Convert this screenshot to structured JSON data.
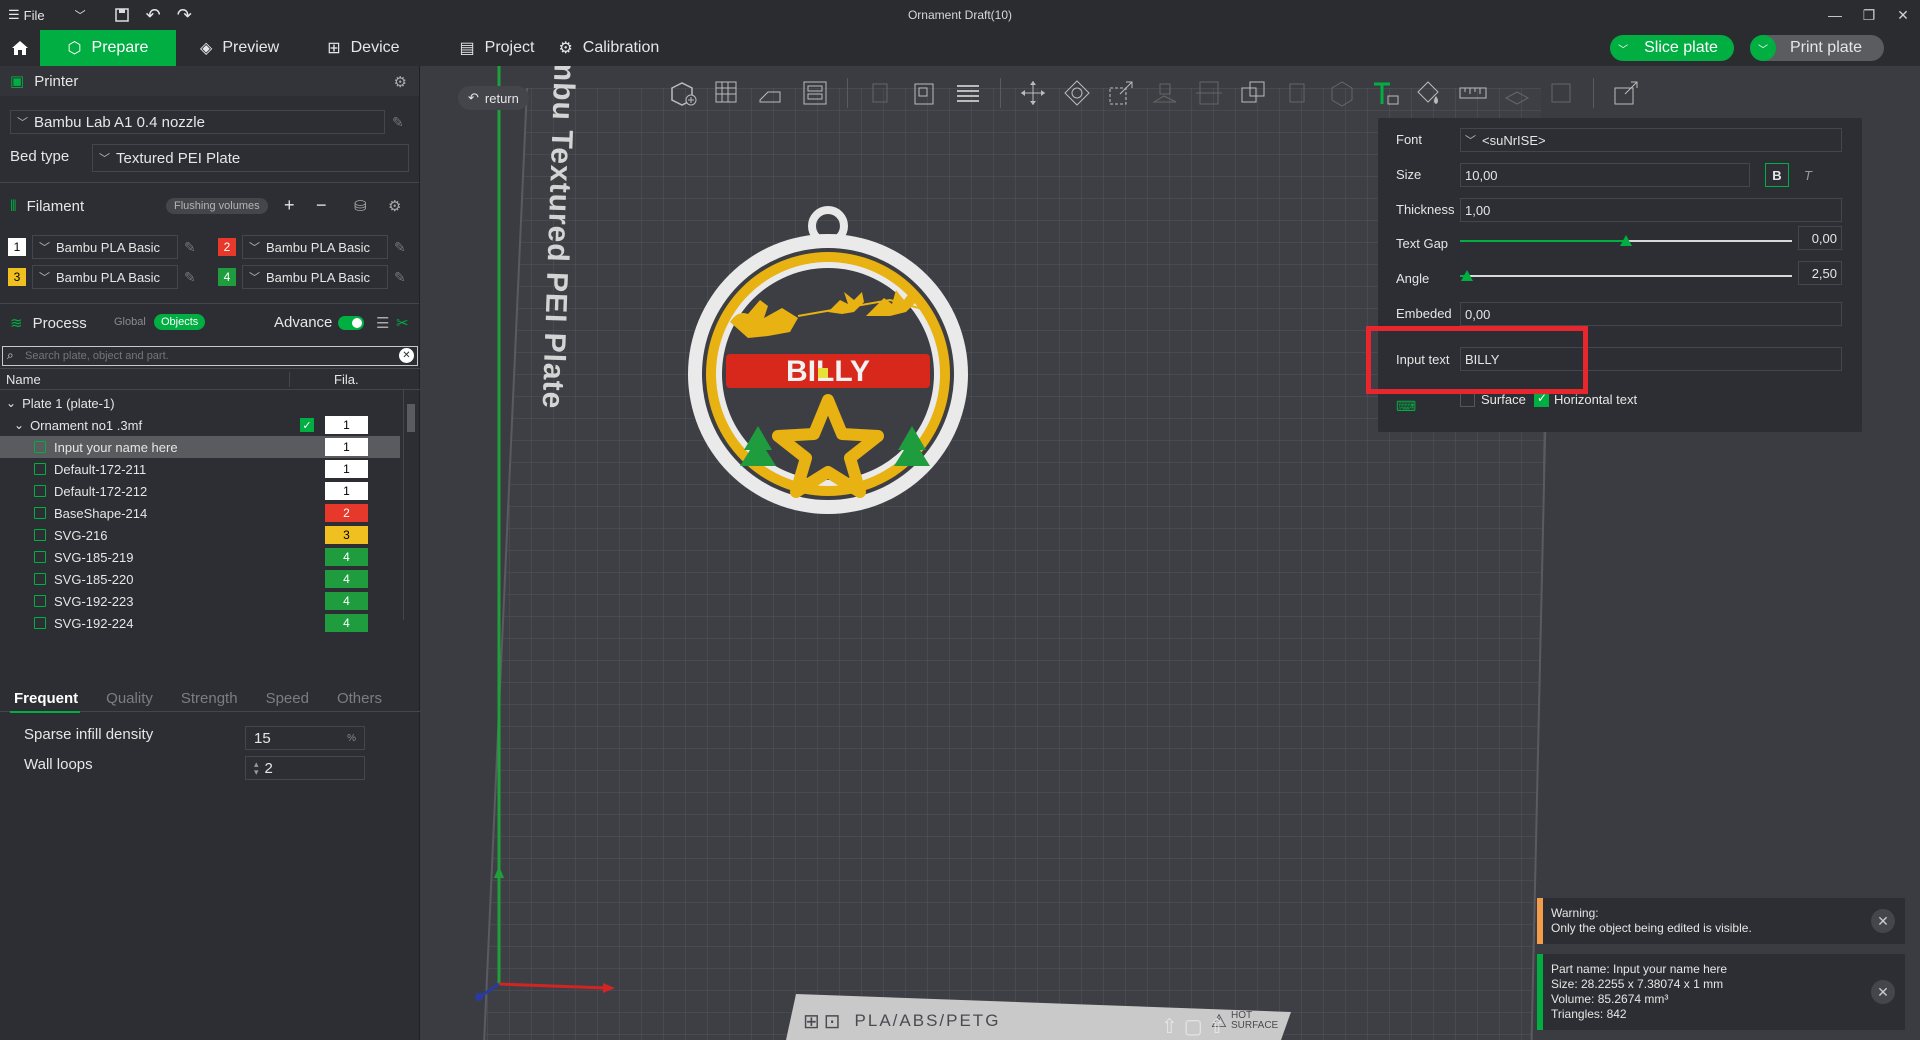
{
  "titlebar": {
    "file_label": "File",
    "title": "Ornament Draft(10)"
  },
  "nav": {
    "tabs": [
      "Prepare",
      "Preview",
      "Device",
      "Project",
      "Calibration"
    ],
    "slice_label": "Slice plate",
    "print_label": "Print plate"
  },
  "sidebar": {
    "printer_title": "Printer",
    "printer_value": "Bambu Lab A1 0.4 nozzle",
    "bed_type_label": "Bed type",
    "bed_type_value": "Textured PEI Plate",
    "filament_title": "Filament",
    "flushing_label": "Flushing volumes",
    "filaments": [
      {
        "num": "1",
        "name": "Bambu PLA Basic",
        "color": "#ffffff",
        "text_color": "#000000"
      },
      {
        "num": "2",
        "name": "Bambu PLA Basic",
        "color": "#e6392b",
        "text_color": "#ffffff"
      },
      {
        "num": "3",
        "name": "Bambu PLA Basic",
        "color": "#f0c020",
        "text_color": "#000000"
      },
      {
        "num": "4",
        "name": "Bambu PLA Basic",
        "color": "#1f9d3e",
        "text_color": "#ffffff"
      }
    ],
    "process_title": "Process",
    "process_global": "Global",
    "process_objects": "Objects",
    "advance_label": "Advance",
    "search_placeholder": "Search plate, object and part.",
    "tree_col_name": "Name",
    "tree_col_fila": "Fila.",
    "tree_rows": [
      {
        "label": "Plate 1 (plate-1)",
        "fila": "",
        "color": ""
      },
      {
        "label": "Ornament no1 .3mf",
        "fila": "1",
        "color": "#ffffff"
      },
      {
        "label": "Input your name here",
        "fila": "1",
        "color": "#ffffff"
      },
      {
        "label": "Default-172-211",
        "fila": "1",
        "color": "#ffffff"
      },
      {
        "label": "Default-172-212",
        "fila": "1",
        "color": "#ffffff"
      },
      {
        "label": "BaseShape-214",
        "fila": "2",
        "color": "#e6392b"
      },
      {
        "label": "SVG-216",
        "fila": "3",
        "color": "#f0c020"
      },
      {
        "label": "SVG-185-219",
        "fila": "4",
        "color": "#1f9d3e"
      },
      {
        "label": "SVG-185-220",
        "fila": "4",
        "color": "#1f9d3e"
      },
      {
        "label": "SVG-192-223",
        "fila": "4",
        "color": "#1f9d3e"
      },
      {
        "label": "SVG-192-224",
        "fila": "4",
        "color": "#1f9d3e"
      }
    ],
    "setting_tabs": [
      "Frequent",
      "Quality",
      "Strength",
      "Speed",
      "Others"
    ],
    "sparse_label": "Sparse infill density",
    "sparse_value": "15",
    "sparse_unit": "%",
    "wall_label": "Wall loops",
    "wall_value": "2"
  },
  "viewport": {
    "return_label": "return",
    "plate_label": "mbu Textured PEI Plate",
    "ornament_text": "BILLY",
    "bottom_strip_label": "PLA/ABS/PETG",
    "hot_surface_label": "HOT SURFACE"
  },
  "text_panel": {
    "font_label": "Font",
    "font_value": "<suNrISE>",
    "size_label": "Size",
    "size_value": "10,00",
    "bold_label": "B",
    "italic_label": "T",
    "thickness_label": "Thickness",
    "thickness_value": "1,00",
    "gap_label": "Text Gap",
    "gap_value": "0,00",
    "gap_fraction": 0.5,
    "angle_label": "Angle",
    "angle_value": "2,50",
    "angle_fraction": 0.02,
    "embeded_label": "Embeded",
    "embeded_value": "0,00",
    "input_label": "Input text",
    "input_value": "BILLY",
    "surface_label": "Surface",
    "horizontal_label": "Horizontal text"
  },
  "notifications": {
    "warning_title": "Warning:",
    "warning_text": "Only the object being edited is visible.",
    "part_line1": "Part name: Input your name here",
    "part_line2": "Size: 28.2255 x 7.38074 x 1 mm",
    "part_line3": "Volume: 85.2674 mm³",
    "part_line4": "Triangles: 842"
  }
}
